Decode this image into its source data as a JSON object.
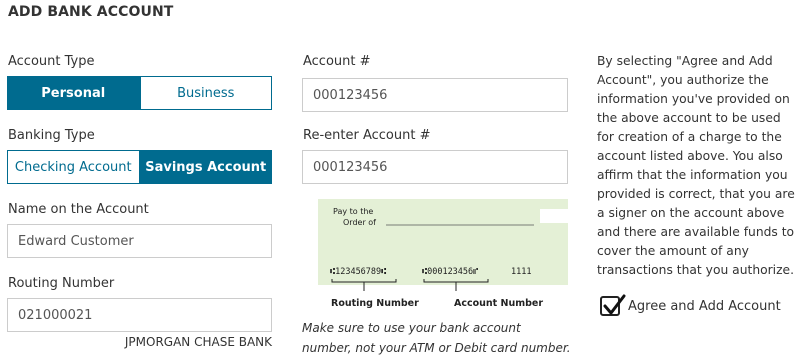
{
  "page": {
    "title": "ADD BANK ACCOUNT"
  },
  "account_type": {
    "label": "Account Type",
    "options": [
      "Personal",
      "Business"
    ],
    "selected": "Personal"
  },
  "banking_type": {
    "label": "Banking Type",
    "options": [
      "Checking Account",
      "Savings Account"
    ],
    "selected": "Savings Account"
  },
  "name_on_account": {
    "label": "Name on the Account",
    "value": "Edward Customer"
  },
  "routing_number": {
    "label": "Routing Number",
    "value": "021000021",
    "bank_name": "JPMORGAN CHASE BANK"
  },
  "account_number": {
    "label": "Account #",
    "value": "000123456"
  },
  "reenter_account": {
    "label": "Re-enter Account #",
    "value": "000123456"
  },
  "check_image": {
    "pay_to_line1": "Pay to the",
    "pay_to_line2": "Order of",
    "micr_routing": "⑆123456789⑆",
    "micr_account": "⑆000123456⑈",
    "micr_check": "1111",
    "routing_caption": "Routing Number",
    "account_caption": "Account Number",
    "colors": {
      "paper": "#e4f0d6"
    }
  },
  "check_note": "Make sure to use your bank account number, not your ATM or Debit card number.",
  "authorization_text": "By selecting \"Agree and Add Account\", you authorize the information you've provided on the above account to be used for creation of a charge to the account listed above. You also affirm that the information you provided is correct, that you are a signer on the account above and there are available funds to cover the amount of any transactions that you authorize.",
  "agree": {
    "label": "Agree and Add Account",
    "checked": true,
    "icon": "checkmark-icon"
  },
  "colors": {
    "accent": "#006b8f",
    "text": "#333333",
    "border": "#cccccc"
  }
}
